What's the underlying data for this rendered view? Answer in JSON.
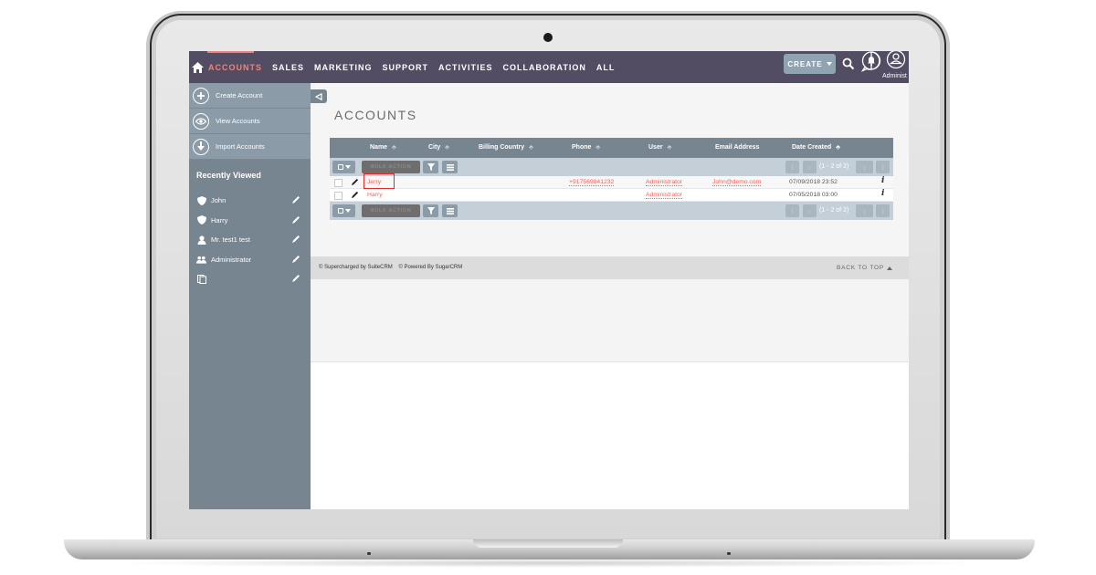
{
  "topnav": {
    "items": [
      {
        "label": "ACCOUNTS",
        "active": true
      },
      {
        "label": "SALES",
        "active": false
      },
      {
        "label": "MARKETING",
        "active": false
      },
      {
        "label": "SUPPORT",
        "active": false
      },
      {
        "label": "ACTIVITIES",
        "active": false
      },
      {
        "label": "COLLABORATION",
        "active": false
      },
      {
        "label": "ALL",
        "active": false
      }
    ],
    "create_label": "CREATE",
    "user_label": "Administ",
    "accent_color": "#f08377",
    "bar_color": "#534d64"
  },
  "sidebar": {
    "actions": [
      {
        "label": "Create Account",
        "icon": "plus-circle-icon"
      },
      {
        "label": "View Accounts",
        "icon": "eye-circle-icon"
      },
      {
        "label": "Import Accounts",
        "icon": "download-circle-icon"
      }
    ],
    "recently_viewed_title": "Recently Viewed",
    "recently_viewed": [
      {
        "label": "John",
        "icon": "shield-icon"
      },
      {
        "label": "Harry",
        "icon": "shield-icon"
      },
      {
        "label": "Mr. test1 test",
        "icon": "person-icon"
      },
      {
        "label": "Administrator",
        "icon": "users-icon"
      },
      {
        "label": "",
        "icon": "document-icon"
      }
    ]
  },
  "main": {
    "title": "ACCOUNTS",
    "table": {
      "columns": [
        "Name",
        "City",
        "Billing Country",
        "Phone",
        "User",
        "Email Address",
        "Date Created"
      ],
      "bulk_action_label": "BULK ACTION",
      "pagination_text": "(1 - 2 of 2)",
      "rows": [
        {
          "name": "Jerry",
          "city": "",
          "billing_country": "",
          "phone": "+917569841232",
          "user": "Administrator",
          "email": "John@demo.com",
          "date_created": "07/09/2018 23:52",
          "highlighted": true
        },
        {
          "name": "Harry",
          "city": "",
          "billing_country": "",
          "phone": "",
          "user": "Administrator",
          "email": "",
          "date_created": "07/05/2018 03:00",
          "highlighted": false
        }
      ]
    }
  },
  "footer": {
    "supercharged": "© Supercharged by SuiteCRM",
    "powered": "© Powered By SugarCRM",
    "back_to_top": "BACK TO TOP"
  }
}
